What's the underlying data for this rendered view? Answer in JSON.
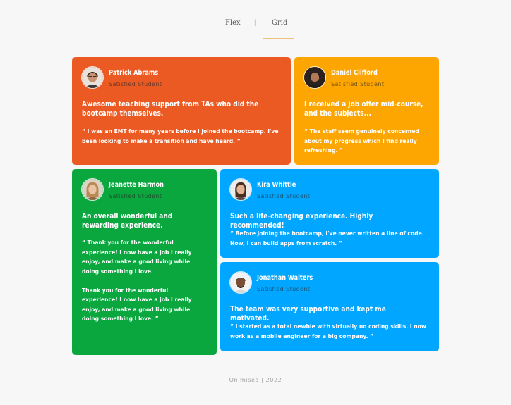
{
  "tabs": [
    {
      "label": "Flex"
    },
    {
      "label": "Grid"
    }
  ],
  "tab_separator": "|",
  "cards": [
    {
      "name": "Patrick Abrams",
      "role": "Satisfied Student",
      "headline": "Awesome teaching support from TAs who did the bootcamp themselves.",
      "quote": [
        "“ I was an EMT for many years before I joined the bootcamp. I've been looking to make a transition and have heard. ”"
      ],
      "color": "#ec5a24"
    },
    {
      "name": "Daniel Clifford",
      "role": "Satisfied Student",
      "headline": "I received a job offer mid-course, and the subjects...",
      "quote": [
        "“ The staff seem genuinely concerned about my progress which I find really refreshing. ”"
      ],
      "color": "#fda500"
    },
    {
      "name": "Jeanette Harmon",
      "role": "Satisfied Student",
      "headline": "An overall wonderful and rewarding experience.",
      "quote": [
        "“ Thank you for the wonderful experience! I now have a job I really enjoy, and make a good living while doing something I love.",
        "Thank you for the wonderful experience! I now have a job I really enjoy, and make a good living while doing something I love. ”"
      ],
      "color": "#09a73e"
    },
    {
      "name": "Kira Whittle",
      "role": "Satisfied Student",
      "headline": "Such a life-changing experience. Highly recommended!",
      "quote": [
        "“ Before joining the bootcamp, I've never written a line of code. Now, I can build apps from scratch. ”"
      ],
      "color": "#00a6ff"
    },
    {
      "name": "Jonathan Walters",
      "role": "Satisfied Student",
      "headline": "The team was very supportive and kept me motivated.",
      "quote": [
        "“ I started as a total newbie with virtually no coding skills. I now work as a mobile engineer for a big company. ”"
      ],
      "color": "#00a6ff"
    }
  ],
  "footer": "Onimisea | 2022"
}
